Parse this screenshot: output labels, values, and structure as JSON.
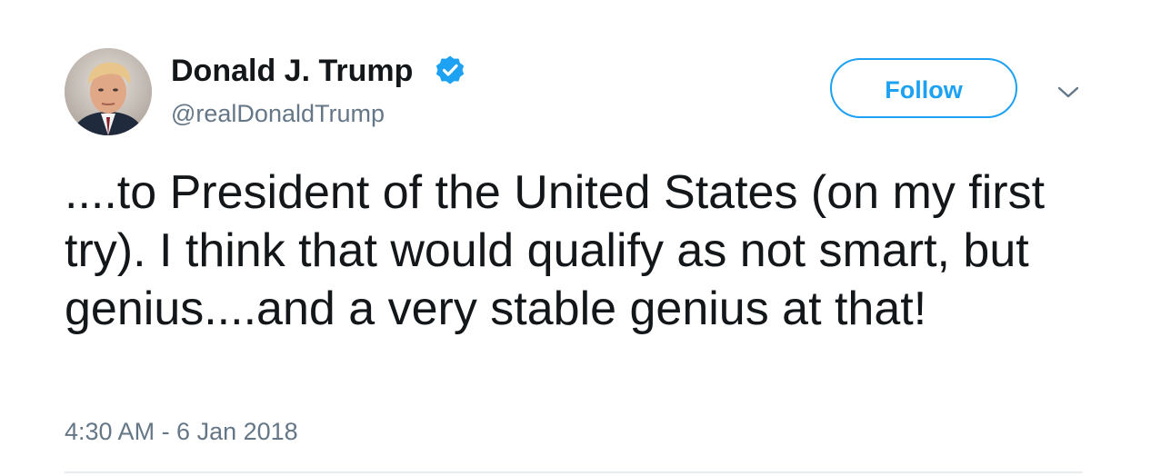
{
  "user": {
    "display_name": "Donald J. Trump",
    "handle": "@realDonaldTrump",
    "verified": true
  },
  "actions": {
    "follow_label": "Follow"
  },
  "tweet": {
    "text": "....to President of the United States (on my first try). I think that would qualify as not smart, but genius....and a very stable genius at that!",
    "timestamp": "4:30 AM - 6 Jan 2018"
  },
  "colors": {
    "accent": "#1da1f2",
    "text_primary": "#14171a",
    "text_secondary": "#657786",
    "divider": "#e6ecf0"
  },
  "icons": {
    "verified": "verified-badge-icon",
    "menu": "chevron-down-icon"
  }
}
